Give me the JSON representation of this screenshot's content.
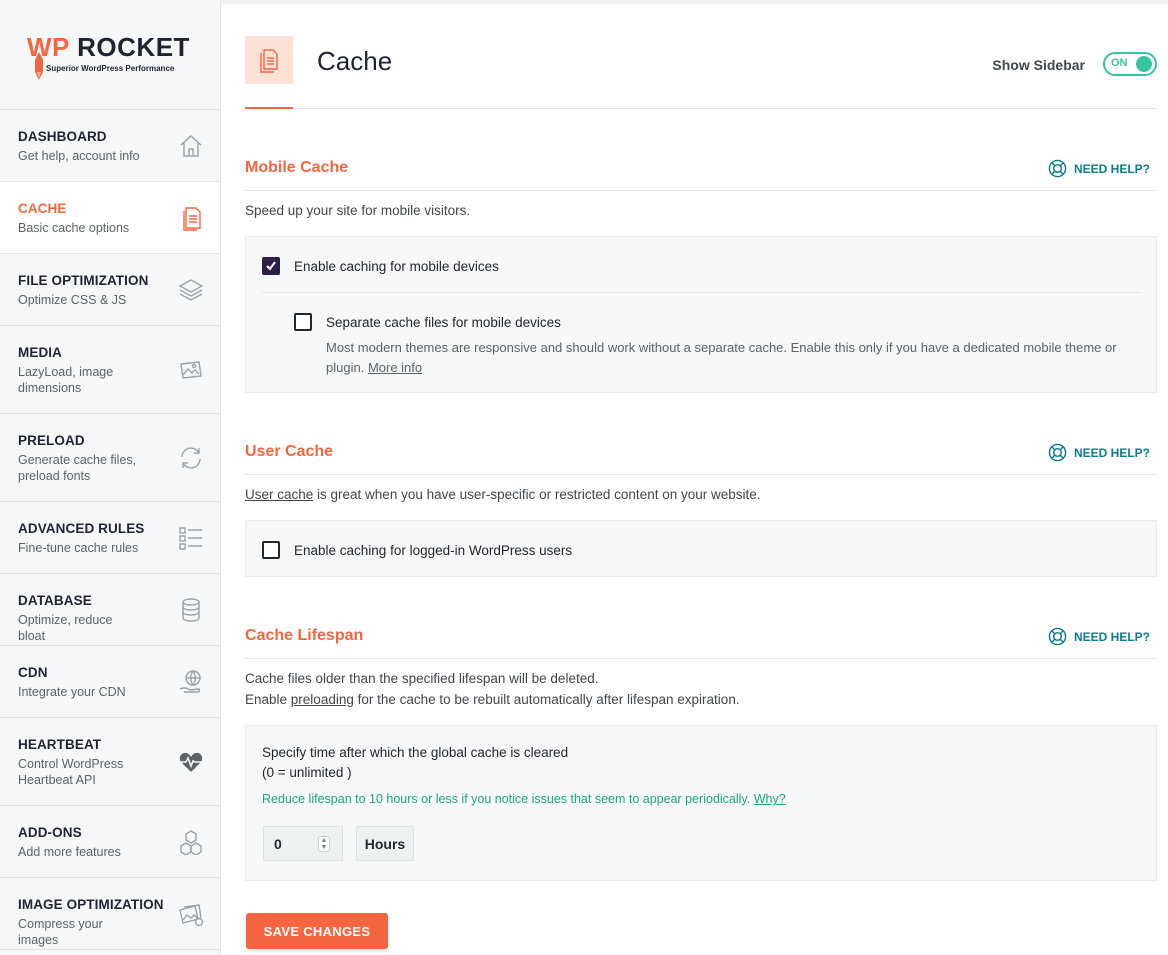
{
  "brand": {
    "wp": "WP",
    "rocket": "ROCKET",
    "tagline": "Superior WordPress Performance",
    "accent": "#f56640",
    "success": "#38c49c",
    "link": "#0c7b8c"
  },
  "sidebar": {
    "items": [
      {
        "title": "DASHBOARD",
        "sub": "Get help, account info",
        "icon": "home-icon"
      },
      {
        "title": "CACHE",
        "sub": "Basic cache options",
        "icon": "document-icon",
        "active": true
      },
      {
        "title": "FILE OPTIMIZATION",
        "sub": "Optimize CSS & JS",
        "icon": "layers-icon"
      },
      {
        "title": "MEDIA",
        "sub": "LazyLoad, image dimensions",
        "icon": "image-icon"
      },
      {
        "title": "PRELOAD",
        "sub": "Generate cache files, preload fonts",
        "icon": "refresh-icon"
      },
      {
        "title": "ADVANCED RULES",
        "sub": "Fine-tune cache rules",
        "icon": "checklist-icon"
      },
      {
        "title": "DATABASE",
        "sub": "Optimize, reduce bloat",
        "icon": "database-icon"
      },
      {
        "title": "CDN",
        "sub": "Integrate your CDN",
        "icon": "globe-hand-icon"
      },
      {
        "title": "HEARTBEAT",
        "sub": "Control WordPress Heartbeat API",
        "icon": "heartbeat-icon"
      },
      {
        "title": "ADD-ONS",
        "sub": "Add more features",
        "icon": "cubes-icon"
      },
      {
        "title": "IMAGE OPTIMIZATION",
        "sub": "Compress your images",
        "icon": "images-icon"
      }
    ]
  },
  "header": {
    "title": "Cache",
    "sidebar_label": "Show Sidebar",
    "toggle_label": "ON"
  },
  "help_label": "NEED HELP?",
  "mobile": {
    "title": "Mobile Cache",
    "desc": "Speed up your site for mobile visitors.",
    "enable_label": "Enable caching for mobile devices",
    "enable_checked": true,
    "separate_label": "Separate cache files for mobile devices",
    "separate_checked": false,
    "separate_desc": "Most modern themes are responsive and should work without a separate cache. Enable this only if you have a dedicated mobile theme or plugin.",
    "more_info": "More info"
  },
  "user": {
    "title": "User Cache",
    "desc_link": "User cache",
    "desc_rest": " is great when you have user-specific or restricted content on your website.",
    "enable_label": "Enable caching for logged-in WordPress users",
    "enable_checked": false
  },
  "lifespan": {
    "title": "Cache Lifespan",
    "desc1": "Cache files older than the specified lifespan will be deleted.",
    "desc2_pre": "Enable ",
    "desc2_link": "preloading",
    "desc2_post": " for the cache to be rebuilt automatically after lifespan expiration.",
    "field_label": "Specify time after which the global cache is cleared",
    "field_hint": "(0 = unlimited )",
    "note": "Reduce lifespan to 10 hours or less if you notice issues that seem to appear periodically.",
    "note_link": "Why?",
    "value": "0",
    "unit": "Hours"
  },
  "save_label": "SAVE CHANGES"
}
